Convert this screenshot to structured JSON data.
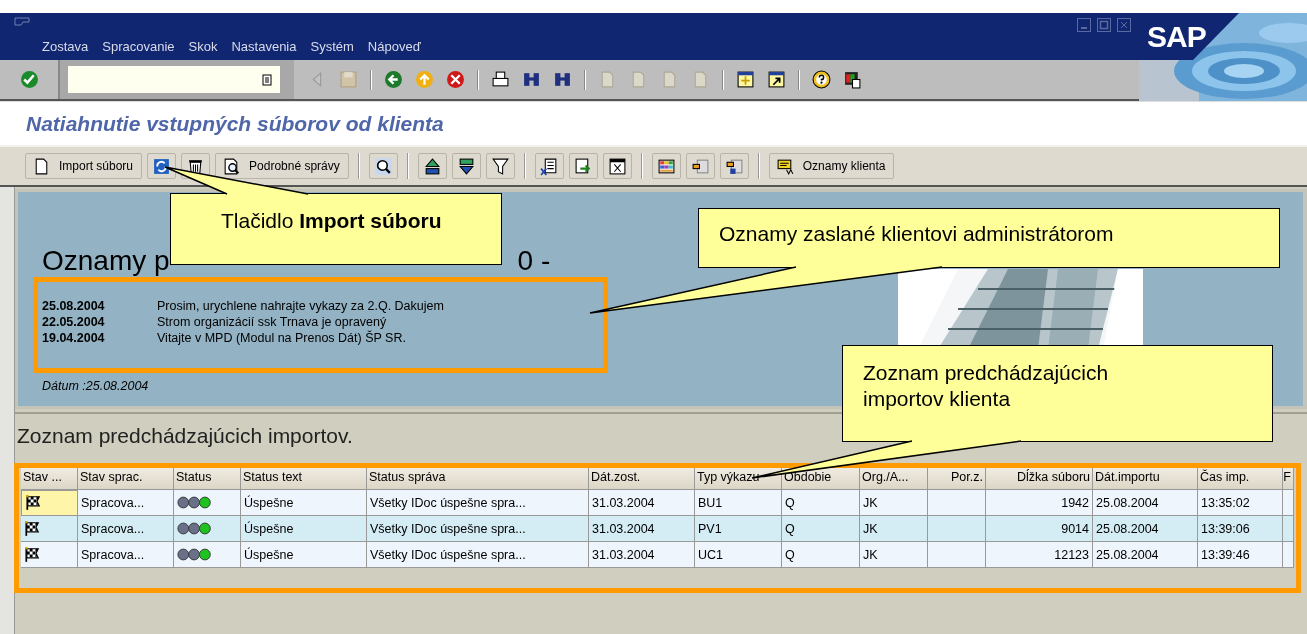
{
  "window": {
    "logo": "SAP",
    "menu": [
      {
        "label": "Zostava"
      },
      {
        "label": "Spracovanie"
      },
      {
        "label": "Skok"
      },
      {
        "label": "Nastavenia"
      },
      {
        "label": "Systém"
      },
      {
        "label": "Nápoveď"
      }
    ]
  },
  "screen_title": "Natiahnutie vstupných súborov od klienta",
  "app_toolbar": {
    "buttons": [
      {
        "label": "Import súboru"
      },
      {
        "label": "Podrobné správy"
      },
      {
        "label": "Oznamy klienta"
      }
    ]
  },
  "notices_panel": {
    "heading_parts": [
      "Oznamy p",
      "0 -"
    ],
    "notices": [
      {
        "date": "25.08.2004",
        "text": "Prosim, urychlene nahrajte vykazy za 2.Q. Dakujem"
      },
      {
        "date": "22.05.2004",
        "text": "Strom organizácií ssk Trnava je opravený"
      },
      {
        "date": "19.04.2004",
        "text": "Vitajte v MPD (Modul na Prenos Dát) ŠP SR."
      }
    ],
    "date_line": "Dátum :25.08.2004",
    "image": {
      "kind": "picture"
    }
  },
  "imports": {
    "heading": "Zoznam predchádzajúcich importov.",
    "columns": [
      {
        "label": "Stav ...",
        "kind": "flag"
      },
      {
        "label": "Stav sprac.",
        "kind": "text"
      },
      {
        "label": "Status",
        "kind": "light"
      },
      {
        "label": "Status text",
        "kind": "text"
      },
      {
        "label": "Status správa",
        "kind": "text"
      },
      {
        "label": "Dát.zost.",
        "kind": "text"
      },
      {
        "label": "Typ výkazu",
        "kind": "text"
      },
      {
        "label": "Obdobie",
        "kind": "text"
      },
      {
        "label": "Org./A...",
        "kind": "text"
      },
      {
        "label": "Por.z.",
        "kind": "blank"
      },
      {
        "label": "Dĺžka súboru",
        "kind": "num"
      },
      {
        "label": "Dát.importu",
        "kind": "text"
      },
      {
        "label": "Čas imp.",
        "kind": "text"
      },
      {
        "label": "F",
        "kind": "blank"
      }
    ],
    "rows": [
      {
        "current": true,
        "kind": "green",
        "cells": [
          "",
          "Spracova...",
          "",
          "Úspešne",
          "Všetky IDoc úspešne spra...",
          "31.03.2004",
          "BU1",
          "Q",
          "JK",
          "",
          "1942",
          "25.08.2004",
          "13:35:02",
          ""
        ]
      },
      {
        "current": false,
        "kind": "green",
        "cells": [
          "",
          "Spracova...",
          "",
          "Úspešne",
          "Všetky IDoc úspešne spra...",
          "31.03.2004",
          "PV1",
          "Q",
          "JK",
          "",
          "9014",
          "25.08.2004",
          "13:39:06",
          ""
        ]
      },
      {
        "current": false,
        "kind": "green",
        "cells": [
          "",
          "Spracova...",
          "",
          "Úspešne",
          "Všetky IDoc úspešne spra...",
          "31.03.2004",
          "UC1",
          "Q",
          "JK",
          "",
          "12123",
          "25.08.2004",
          "13:39:46",
          ""
        ]
      }
    ]
  },
  "callouts": [
    {
      "text": "Tlačidlo **Import súboru**"
    },
    {
      "text": "Oznamy zaslané klientovi administrátorom"
    },
    {
      "text": "Zoznam predchádzajúcich importov klienta"
    }
  ]
}
